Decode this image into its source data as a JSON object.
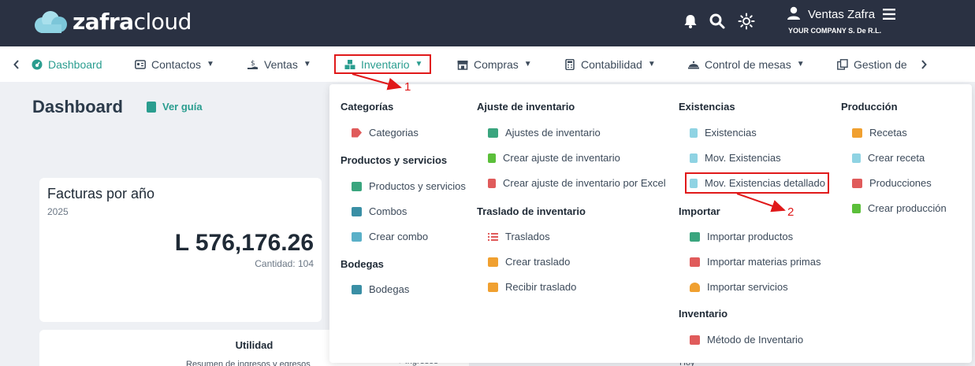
{
  "topbar": {
    "logo_bold": "zafra",
    "logo_light": "cloud",
    "user_name": "Ventas Zafra",
    "company": "YOUR COMPANY S. De R.L."
  },
  "nav": {
    "items": [
      {
        "label": "Dashboard"
      },
      {
        "label": "Contactos"
      },
      {
        "label": "Ventas"
      },
      {
        "label": "Inventario"
      },
      {
        "label": "Compras"
      },
      {
        "label": "Contabilidad"
      },
      {
        "label": "Control de mesas"
      },
      {
        "label": "Gestion de"
      }
    ]
  },
  "page": {
    "title": "Dashboard",
    "guide_link": "Ver guía"
  },
  "cards": {
    "invoices": {
      "title": "Facturas por año",
      "year": "2025",
      "amount": "L 576,176.26",
      "count": "Cantidad: 104"
    },
    "profit": {
      "title": "Utilidad",
      "subtitle": "Resumen de ingresos y egresos"
    },
    "ingresos_legend": "Ingresos",
    "hoy_label": "Hoy"
  },
  "dropdown": {
    "col1": {
      "sec1": "Categorías",
      "categorias": "Categorias",
      "sec2": "Productos y servicios",
      "productos": "Productos y servicios",
      "combos": "Combos",
      "crear_combo": "Crear combo",
      "sec3": "Bodegas",
      "bodegas": "Bodegas"
    },
    "col2": {
      "sec1": "Ajuste de inventario",
      "ajustes": "Ajustes de inventario",
      "crear_ajuste": "Crear ajuste de inventario",
      "crear_ajuste_excel": "Crear ajuste de inventario por Excel",
      "sec2": "Traslado de inventario",
      "traslados": "Traslados",
      "crear_traslado": "Crear traslado",
      "recibir_traslado": "Recibir traslado"
    },
    "col3": {
      "sec1": "Existencias",
      "existencias": "Existencias",
      "mov_existencias": "Mov. Existencias",
      "mov_detallado": "Mov. Existencias detallado",
      "sec2": "Importar",
      "importar_productos": "Importar productos",
      "importar_materias": "Importar materias primas",
      "importar_servicios": "Importar servicios",
      "sec3": "Inventario",
      "metodo": "Método de Inventario"
    },
    "col4": {
      "sec1": "Producción",
      "recetas": "Recetas",
      "crear_receta": "Crear receta",
      "producciones": "Producciones",
      "crear_produccion": "Crear producción"
    }
  },
  "annotations": {
    "one": "1",
    "two": "2"
  },
  "colors": {
    "topbar": "#2a3142",
    "accent": "#2a9d8f",
    "annotation": "#e0191a"
  }
}
